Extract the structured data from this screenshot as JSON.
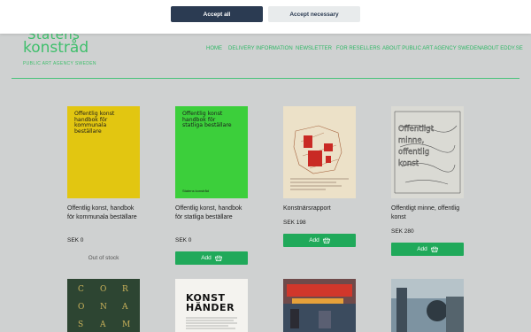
{
  "cookie_banner": {
    "accept_all_label": "Accept all",
    "accept_necessary_label": "Accept necessary"
  },
  "header": {
    "logo_line1": "Statens",
    "logo_line2": "konstråd",
    "logo_subtitle": "PUBLIC ART AGENCY SWEDEN",
    "nav": [
      {
        "label": "HOME"
      },
      {
        "label": "DELIVERY INFORMATION"
      },
      {
        "label": "NEWSLETTER"
      },
      {
        "label": "FOR RESELLERS"
      },
      {
        "label": "ABOUT PUBLIC ART AGENCY SWEDEN"
      },
      {
        "label": "ABOUT EDDY.SE"
      }
    ]
  },
  "products": [
    {
      "title": "Offentlig konst, handbok för kommunala beställare",
      "price": "SEK 0",
      "stock": "Out of stock",
      "cover_text": "Offentlig konst\nhandbok för\nkommunala\nbeställare",
      "cover_color": "#e2c611"
    },
    {
      "title": "Offentlig konst, handbok för statliga beställare",
      "price": "SEK 0",
      "add_label": "Add",
      "cover_text": "Offentlig konst\nhandbok för\nstatliga beställare",
      "cover_footer": "Statens konstråd",
      "cover_color": "#3ccf3b"
    },
    {
      "title": "Konstnärsrapport",
      "price": "SEK 198",
      "add_label": "Add",
      "cover_color": "#ece1c8"
    },
    {
      "title": "Offentligt minne, offentlig konst",
      "price": "SEK 280",
      "add_label": "Add",
      "cover_text": "Offentligt\nminne,\noffentlig\nkonst",
      "cover_color": "#dadad4"
    },
    {
      "cover_letters": [
        "C",
        "O",
        "R",
        "O",
        "N",
        "A",
        "S",
        "A",
        "M"
      ],
      "cover_color": "#2d4532"
    },
    {
      "cover_text": "KONST\nHÄNDER",
      "cover_color": "#f4f3ef"
    },
    {
      "cover_color": "#7c3836"
    },
    {
      "cover_color": "#4e6777"
    }
  ]
}
